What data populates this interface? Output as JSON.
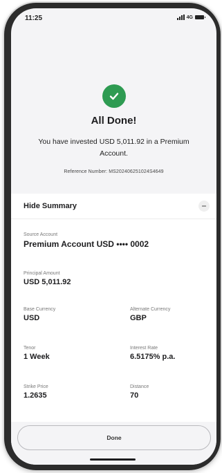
{
  "status_bar": {
    "time": "11:25",
    "network": "4G"
  },
  "success": {
    "title": "All Done!",
    "message": "You have invested USD 5,011.92 in a Premium Account.",
    "reference": "Reference Number: MS202406251024S4649",
    "check_color": "#2e9b52"
  },
  "summary": {
    "toggle_label": "Hide Summary",
    "source_account": {
      "label": "Source Account",
      "value": "Premium Account USD •••• 0002"
    },
    "principal_amount": {
      "label": "Principal Amount",
      "value": "USD 5,011.92"
    },
    "base_currency": {
      "label": "Base Currency",
      "value": "USD"
    },
    "alternate_currency": {
      "label": "Alternate Currency",
      "value": "GBP"
    },
    "tenor": {
      "label": "Tenor",
      "value": "1 Week"
    },
    "interest_rate": {
      "label": "Interest Rate",
      "value": "6.5175% p.a."
    },
    "strike_price": {
      "label": "Strike Price",
      "value": "1.2635"
    },
    "distance": {
      "label": "Distance",
      "value": "70"
    }
  },
  "actions": {
    "done_label": "Done"
  }
}
